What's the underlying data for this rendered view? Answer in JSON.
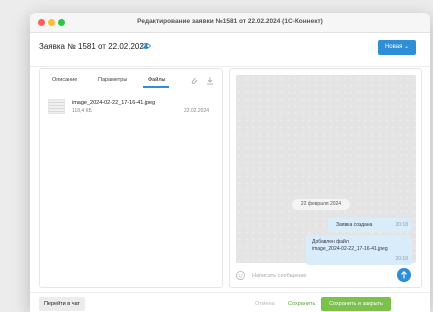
{
  "window": {
    "title": "Редактирование заявки №1581 от 22.02.2024 (1С-Коннект)"
  },
  "header": {
    "request_title": "Заявка № 1581 от 22.02.2024",
    "status_label": "Новая",
    "accent_color": "#2f8fd6"
  },
  "tabs": [
    {
      "label": "Описание"
    },
    {
      "label": "Параметры"
    },
    {
      "label": "Файлы"
    }
  ],
  "active_tab": "Файлы",
  "files": [
    {
      "name": "image_2024-02-22_17-16-41.jpeg",
      "size": "118,4 КБ",
      "date": "22.02.2024"
    }
  ],
  "chat": {
    "date_separator": "22 февраля 2024",
    "messages": [
      {
        "text": "Заявка создана",
        "time": "20:18"
      },
      {
        "line1": "Добавлен файл",
        "line2": "image_2024-02-22_17-16-41.jpeg",
        "time": "20:18"
      }
    ],
    "input_placeholder": "Написать сообщение"
  },
  "footer": {
    "goto_chat": "Перейти в чат",
    "cancel": "Отмена",
    "save": "Сохранить",
    "save_close": "Сохранить и закрыть"
  }
}
